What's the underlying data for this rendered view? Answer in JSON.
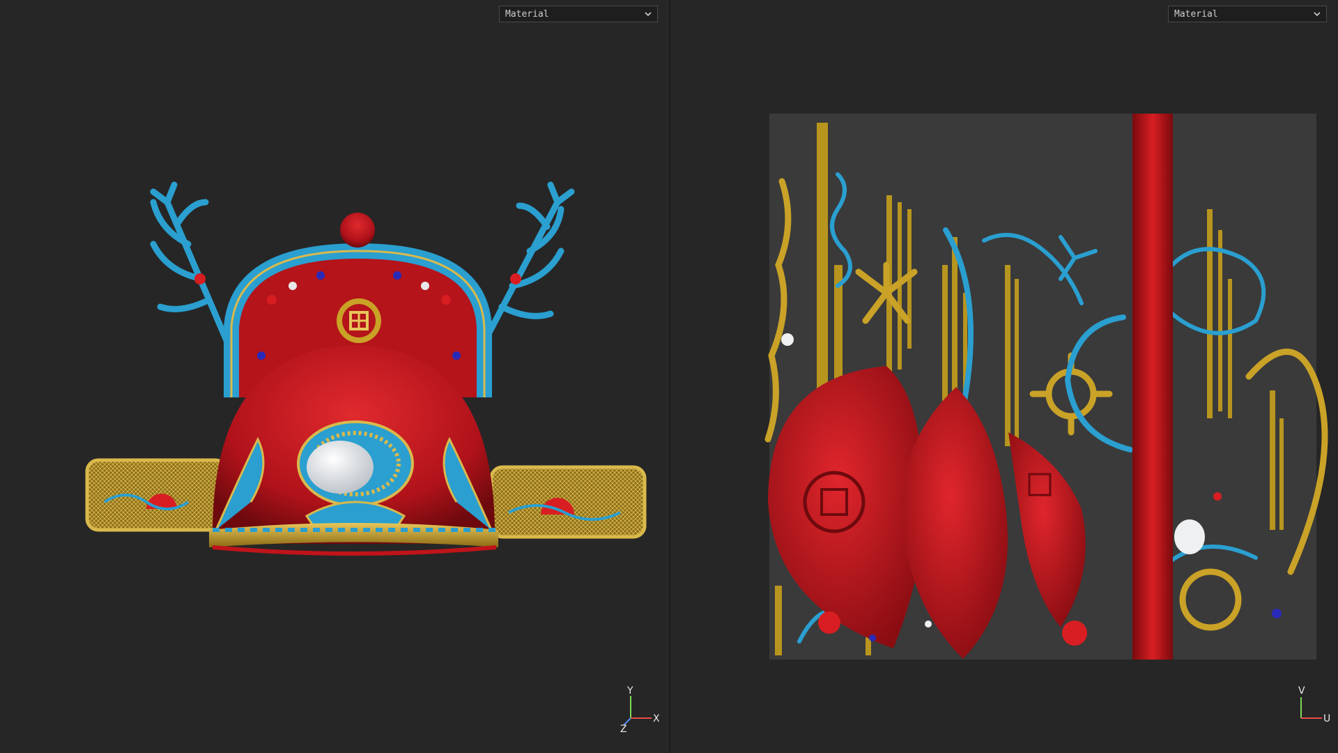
{
  "viewport_3d": {
    "shading_mode": "Material",
    "axes": {
      "up": "Y",
      "right": "X",
      "depth": "Z"
    }
  },
  "viewport_uv": {
    "shading_mode": "Material",
    "axes": {
      "up": "V",
      "right": "U"
    }
  },
  "colors": {
    "background": "#262626",
    "hat_red": "#c0141a",
    "enamel_blue": "#2a9fd0",
    "gold": "#c9a227",
    "pearl": "#eef0f2",
    "uv_backdrop": "#3a3a3a"
  },
  "icons": [
    "chevron-down-icon",
    "axis-gizmo-icon",
    "uv-axis-gizmo-icon"
  ]
}
